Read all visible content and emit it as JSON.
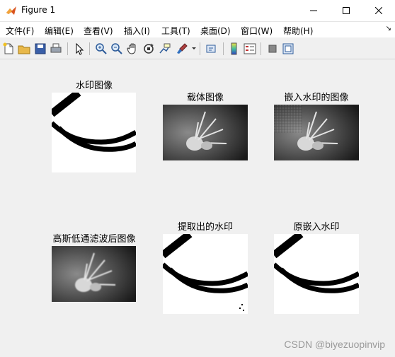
{
  "window": {
    "title": "Figure 1",
    "minimize_symbol": "—",
    "maximize_symbol": "☐",
    "close_symbol": "✕"
  },
  "menu": {
    "items": [
      {
        "label": "文件(F)"
      },
      {
        "label": "编辑(E)"
      },
      {
        "label": "查看(V)"
      },
      {
        "label": "插入(I)"
      },
      {
        "label": "工具(T)"
      },
      {
        "label": "桌面(D)"
      },
      {
        "label": "窗口(W)"
      },
      {
        "label": "帮助(H)"
      }
    ],
    "overflow_symbol": "↘"
  },
  "toolbar": {
    "icons": [
      "new-figure-icon",
      "open-file-icon",
      "save-icon",
      "print-icon",
      "select-arrow-icon",
      "zoom-in-icon",
      "zoom-out-icon",
      "pan-hand-icon",
      "rotate-3d-icon",
      "data-cursor-icon",
      "brush-icon",
      "link-plot-icon",
      "colorbar-icon",
      "legend-icon",
      "hide-plot-tools-icon",
      "show-plot-tools-icon"
    ]
  },
  "figure": {
    "subplots": [
      {
        "title": "水印图像",
        "kind": "watermark"
      },
      {
        "title": "载体图像",
        "kind": "photo"
      },
      {
        "title": "嵌入水印的图像",
        "kind": "photo-noisy"
      },
      {
        "title": "高斯低通滤波后图像",
        "kind": "photo-blur"
      },
      {
        "title": "提取出的水印",
        "kind": "watermark-extracted"
      },
      {
        "title": "原嵌入水印",
        "kind": "watermark"
      }
    ],
    "credit": "CSDN @biyezuopinvip"
  }
}
